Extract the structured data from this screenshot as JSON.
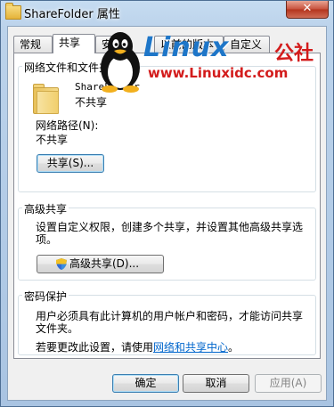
{
  "window": {
    "title": "ShareFolder 属性",
    "close_label": "✕"
  },
  "tabs": [
    {
      "label": "常规"
    },
    {
      "label": "共享"
    },
    {
      "label": "安"
    },
    {
      "label": "以前的版本"
    },
    {
      "label": "自定义"
    }
  ],
  "network_sharing": {
    "legend": "网络文件和文件夹共享",
    "folder_name": "ShareFolder",
    "folder_status": "不共享",
    "path_label": "网络路径(N):",
    "path_value": "不共享",
    "share_button": "共享(S)..."
  },
  "advanced_sharing": {
    "legend": "高级共享",
    "description": "设置自定义权限，创建多个共享，并设置其他高级共享选项。",
    "button": "高级共享(D)..."
  },
  "password_protection": {
    "legend": "密码保护",
    "description": "用户必须具有此计算机的用户帐户和密码，才能访问共享文件夹。",
    "change_text": "若要更改此设置，请使用",
    "link_text": "网络和共享中心",
    "suffix": "。"
  },
  "footer": {
    "ok": "确定",
    "cancel": "取消",
    "apply": "应用(A)"
  },
  "watermark": {
    "brand": "Linux",
    "brand_suffix": "公社",
    "url": "www.Linuxidc.com"
  },
  "colors": {
    "accent": "#1e76c8",
    "watermark_red": "#d31c1c",
    "link": "#0066cc"
  }
}
